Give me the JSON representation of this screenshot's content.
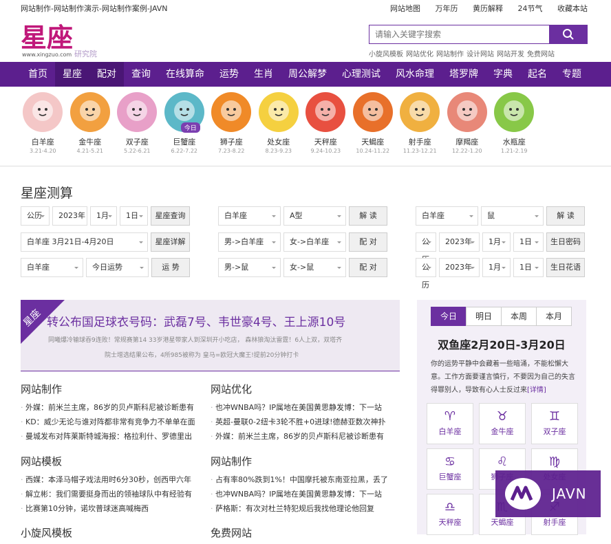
{
  "topbar": {
    "left": "网站制作-网站制作演示-网站制作案例-JAVN",
    "links": [
      "网站地图",
      "万年历",
      "黄历解释",
      "24节气",
      "收藏本站"
    ]
  },
  "logo": {
    "main": "星座",
    "url": "www.xingzuo.com",
    "sub": "研究院"
  },
  "search": {
    "placeholder": "请输入关键字搜索",
    "hotwords": [
      "小旋风模板",
      "网站优化",
      "网站制作",
      "设计网站",
      "网站开发",
      "免费网站"
    ]
  },
  "nav": [
    "首页",
    "星座",
    "配对",
    "查询",
    "在线算命",
    "运势",
    "生肖",
    "周公解梦",
    "心理测试",
    "风水命理",
    "塔罗牌",
    "字典",
    "起名",
    "专题"
  ],
  "zodiac": [
    {
      "name": "白羊座",
      "date": "3.21-4.20",
      "color": "#f4c7c7",
      "icon": "ram-icon"
    },
    {
      "name": "金牛座",
      "date": "4.21-5.21",
      "color": "#f2a040",
      "icon": "bull-icon"
    },
    {
      "name": "双子座",
      "date": "5.22-6.21",
      "color": "#e8a0c8",
      "icon": "twins-icon"
    },
    {
      "name": "巨蟹座",
      "date": "6.22-7.22",
      "color": "#5cb8c8",
      "icon": "crab-icon",
      "tag": "今日"
    },
    {
      "name": "狮子座",
      "date": "7.23-8.22",
      "color": "#f08a28",
      "icon": "lion-icon"
    },
    {
      "name": "处女座",
      "date": "8.23-9.23",
      "color": "#f5d040",
      "icon": "virgin-icon"
    },
    {
      "name": "天秤座",
      "date": "9.24-10.23",
      "color": "#e85040",
      "icon": "scales-icon"
    },
    {
      "name": "天蝎座",
      "date": "10.24-11.22",
      "color": "#e8702a",
      "icon": "scorpion-icon"
    },
    {
      "name": "射手座",
      "date": "11.23-12.21",
      "color": "#f0b040",
      "icon": "archer-icon"
    },
    {
      "name": "摩羯座",
      "date": "12.22-1.20",
      "color": "#e88878",
      "icon": "goat-icon"
    },
    {
      "name": "水瓶座",
      "date": "1.21-2.19",
      "color": "#88c848",
      "icon": "water-bearer-icon"
    }
  ],
  "test": {
    "title": "星座测算",
    "row1": {
      "cal": "公历",
      "year": "2023年",
      "month": "1月",
      "day": "1日",
      "btn": "星座查询",
      "sign": "白羊座",
      "blood": "A型",
      "btn2": "解 读",
      "sign2": "白羊座",
      "animal": "鼠",
      "btn3": "解 读"
    },
    "row2": {
      "range": "白羊座 3月21日-4月20日",
      "btn": "星座详解",
      "a": "男->白羊座",
      "b": "女->白羊座",
      "btn2": "配 对",
      "cal": "公历",
      "year": "2023年",
      "month": "1月",
      "day": "1日",
      "btn3": "生日密码"
    },
    "row3": {
      "sign": "白羊座",
      "fortune": "今日运势",
      "btn": "运 势",
      "a": "男->鼠",
      "b": "女->鼠",
      "btn2": "配 对",
      "cal": "公历",
      "year": "2023年",
      "month": "1月",
      "day": "1日",
      "btn3": "生日花语"
    }
  },
  "banner": {
    "corner": "星座",
    "headline": "转公布国足球衣号码：武磊7号、韦世豪4号、王上源10号",
    "sub1": "同曦爆冷输球吞9连败！常规赛第14 33岁港星带家人到深圳开小吃店， 森林狼淘汰雷霆！6人上双，双塔齐",
    "sub2": "院士增选结果公布，4所985被称为 皇马=欧冠大魔王!提前20分钟打卡"
  },
  "blocks": [
    {
      "title": "网站制作",
      "items": [
        "外媒：前米兰主席，86岁的贝卢斯科尼被诊断患有",
        "KD：威少无论与谁对阵都非常有竞争力不单单在面",
        "曼城发布对阵莱斯特城海报：格拉利什、罗德里出"
      ]
    },
    {
      "title": "网站优化",
      "items": [
        "也冲WNBA吗？IP属地在美国黄思静发博：下一站",
        "英超-曼联0-2纽卡3轮不胜+0进球!德赫亚数次神扑",
        "外媒：前米兰主席，86岁的贝卢斯科尼被诊断患有"
      ]
    },
    {
      "title": "网站模板",
      "items": [
        "西媒：本泽马帽子戏法用时6分30秒，创西甲六年",
        "解立彬：我们需要挺身而出的领袖球队中有经验有",
        "比赛第10分钟，诺坎普球迷高喊梅西"
      ]
    },
    {
      "title": "网站制作",
      "items": [
        "占有率80%跌到1%！中国摩托被东南亚拉黑，丢了",
        "也冲WNBA吗？IP属地在美国黄思静发博：下一站",
        "萨格斯：有次对杜兰特犯规后我找他理论他回复"
      ]
    },
    {
      "title": "小旋风模板",
      "items": []
    },
    {
      "title": "免费网站",
      "items": []
    }
  ],
  "side": {
    "tabs": [
      "今日",
      "明日",
      "本周",
      "本月"
    ],
    "date": "双鱼座2月20日-3月20日",
    "text": "你的运势平静中会藏着一些暗涌，不能松懈大意。工作方面要谨言慎行，不要因为自己的失言得罪别人，导致有心人士反过来",
    "more": "[详情]",
    "signs": [
      {
        "sym": "♈",
        "name": "白羊座"
      },
      {
        "sym": "♉",
        "name": "金牛座"
      },
      {
        "sym": "♊",
        "name": "双子座"
      },
      {
        "sym": "♋",
        "name": "巨蟹座"
      },
      {
        "sym": "♌",
        "name": "狮子座"
      },
      {
        "sym": "♍",
        "name": "处女座"
      },
      {
        "sym": "♎",
        "name": "天秤座"
      },
      {
        "sym": "♏",
        "name": "天蝎座"
      },
      {
        "sym": "♐",
        "name": "射手座"
      }
    ]
  },
  "watermark": "JAVN"
}
